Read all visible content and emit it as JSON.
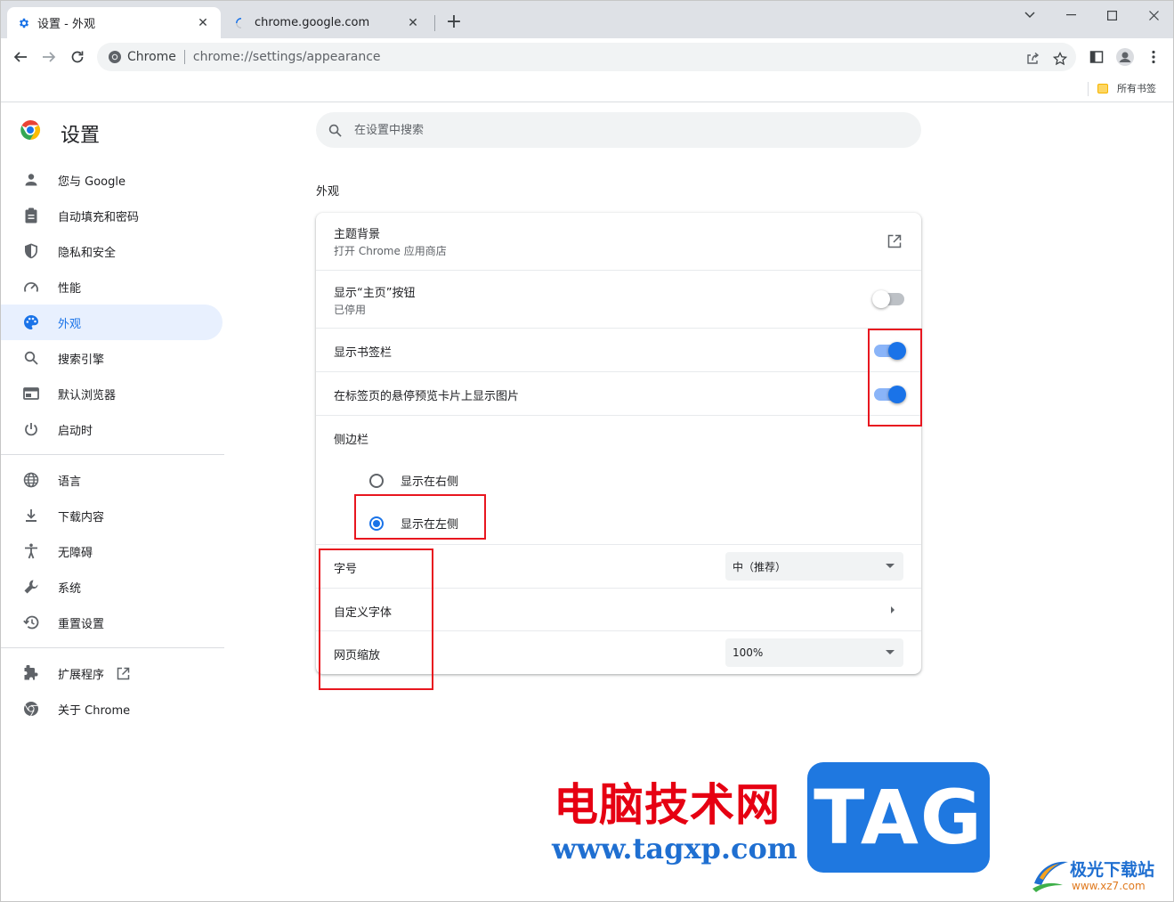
{
  "tabs": [
    {
      "title": "设置 - 外观",
      "icon": "gear-icon",
      "active": true
    },
    {
      "title": "chrome.google.com",
      "icon": "loading-spinner-icon",
      "active": false
    }
  ],
  "toolbar": {
    "omnibox_site": "Chrome",
    "omnibox_url": "chrome://settings/appearance"
  },
  "bookmarks": {
    "all_bookmarks": "所有书签"
  },
  "settings": {
    "title": "设置",
    "search_placeholder": "在设置中搜索"
  },
  "sidebar": {
    "items": [
      {
        "label": "您与 Google",
        "icon": "person-icon"
      },
      {
        "label": "自动填充和密码",
        "icon": "clipboard-icon"
      },
      {
        "label": "隐私和安全",
        "icon": "shield-icon"
      },
      {
        "label": "性能",
        "icon": "speedometer-icon"
      },
      {
        "label": "外观",
        "icon": "palette-icon",
        "selected": true
      },
      {
        "label": "搜索引擎",
        "icon": "search-icon"
      },
      {
        "label": "默认浏览器",
        "icon": "browser-window-icon"
      },
      {
        "label": "启动时",
        "icon": "power-icon"
      },
      {
        "label": "语言",
        "icon": "globe-icon"
      },
      {
        "label": "下载内容",
        "icon": "download-icon"
      },
      {
        "label": "无障碍",
        "icon": "accessibility-icon"
      },
      {
        "label": "系统",
        "icon": "wrench-icon"
      },
      {
        "label": "重置设置",
        "icon": "history-icon"
      },
      {
        "label": "扩展程序",
        "icon": "puzzle-icon"
      },
      {
        "label": "关于 Chrome",
        "icon": "chrome-icon"
      }
    ]
  },
  "appearance": {
    "section_title": "外观",
    "theme": {
      "label": "主题背景",
      "sub": "打开 Chrome 应用商店"
    },
    "home_button": {
      "label": "显示“主页”按钮",
      "sub": "已停用",
      "enabled": false
    },
    "bookmarks_bar": {
      "label": "显示书签栏",
      "enabled": true
    },
    "hover_preview": {
      "label": "在标签页的悬停预览卡片上显示图片",
      "enabled": true
    },
    "side_panel": {
      "label": "侧边栏",
      "options": [
        {
          "label": "显示在右侧",
          "checked": false
        },
        {
          "label": "显示在左侧",
          "checked": true
        }
      ]
    },
    "font_size": {
      "label": "字号",
      "value": "中（推荐）"
    },
    "custom_fonts": {
      "label": "自定义字体"
    },
    "page_zoom": {
      "label": "网页缩放",
      "value": "100%"
    }
  },
  "watermark": {
    "site_cn": "电脑技术网",
    "site_url": "www.tagxp.com",
    "tag": "TAG",
    "brand": "极光下载站",
    "brand_url": "www.xz7.com"
  },
  "colors": {
    "accent": "#1a73e8",
    "annotation": "#e8161f"
  }
}
